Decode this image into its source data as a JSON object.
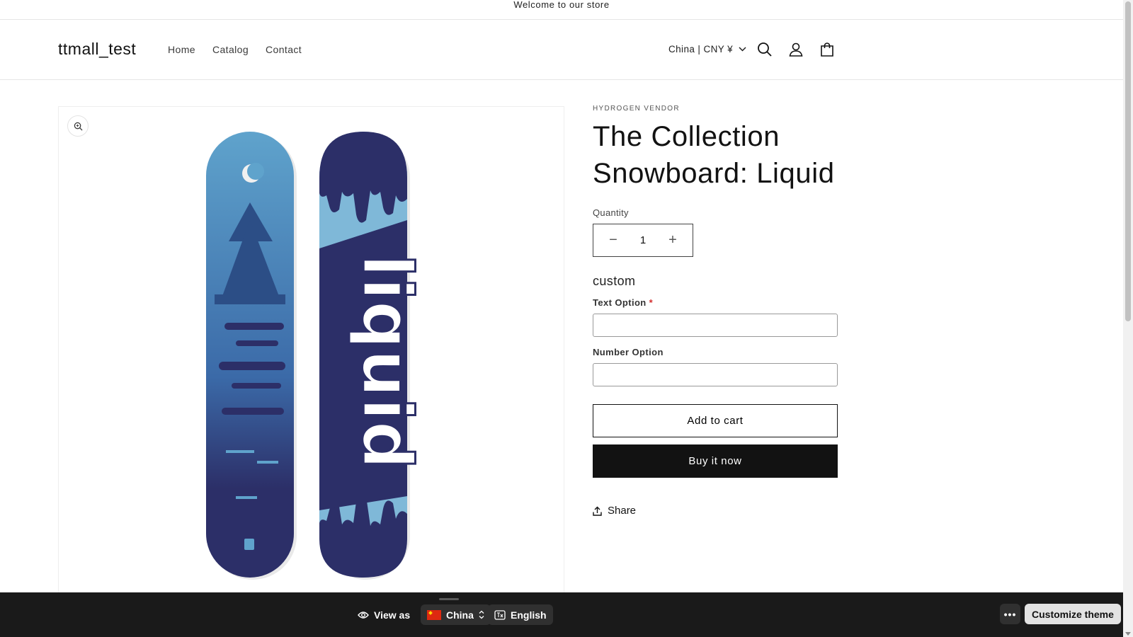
{
  "announcement": {
    "text": "Welcome to our store"
  },
  "header": {
    "logo": "ttmall_test",
    "nav": [
      "Home",
      "Catalog",
      "Contact"
    ],
    "country_selector": "China | CNY ¥",
    "icons": [
      "search-icon",
      "account-icon",
      "cart-icon"
    ]
  },
  "product": {
    "vendor": "HYDROGEN VENDOR",
    "title": "The Collection Snowboard: Liquid",
    "quantity_label": "Quantity",
    "quantity_value": "1",
    "custom_heading": "custom",
    "text_option_label": "Text Option",
    "required_marker": "*",
    "number_option_label": "Number Option",
    "add_to_cart": "Add to cart",
    "buy_now": "Buy it now",
    "share": "Share",
    "image_logo_text": "liquid",
    "colors": {
      "board_light": "#5fa3cc",
      "board_dark": "#2c2f68",
      "accent": "#121212"
    }
  },
  "preview_bar": {
    "view_as": "View as",
    "country": "China",
    "language": "English",
    "more": "•••",
    "customize": "Customize theme"
  }
}
